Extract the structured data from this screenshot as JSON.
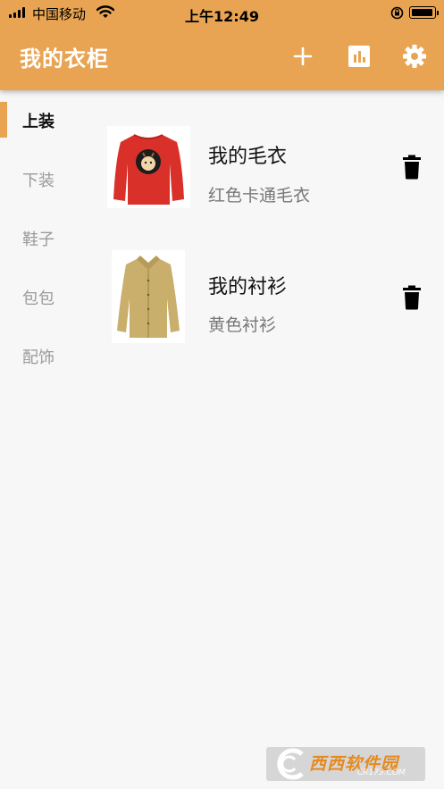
{
  "status_bar": {
    "carrier": "中国移动",
    "time": "上午12:49"
  },
  "header": {
    "title": "我的衣柜",
    "icons": [
      "plus-icon",
      "chart-icon",
      "gear-icon"
    ]
  },
  "categories": [
    {
      "label": "上装",
      "active": true
    },
    {
      "label": "下装",
      "active": false
    },
    {
      "label": "鞋子",
      "active": false
    },
    {
      "label": "包包",
      "active": false
    },
    {
      "label": "配饰",
      "active": false
    }
  ],
  "items": [
    {
      "name": "我的毛衣",
      "desc": "红色卡通毛衣",
      "image": "red-sweater-image"
    },
    {
      "name": "我的衬衫",
      "desc": "黄色衬衫",
      "image": "yellow-shirt-image"
    }
  ],
  "watermark": {
    "main": "西西软件园",
    "sub": "CR173.COM"
  },
  "colors": {
    "accent": "#e8a452",
    "sweater": "#d9312a",
    "shirt": "#c9ae6c"
  }
}
